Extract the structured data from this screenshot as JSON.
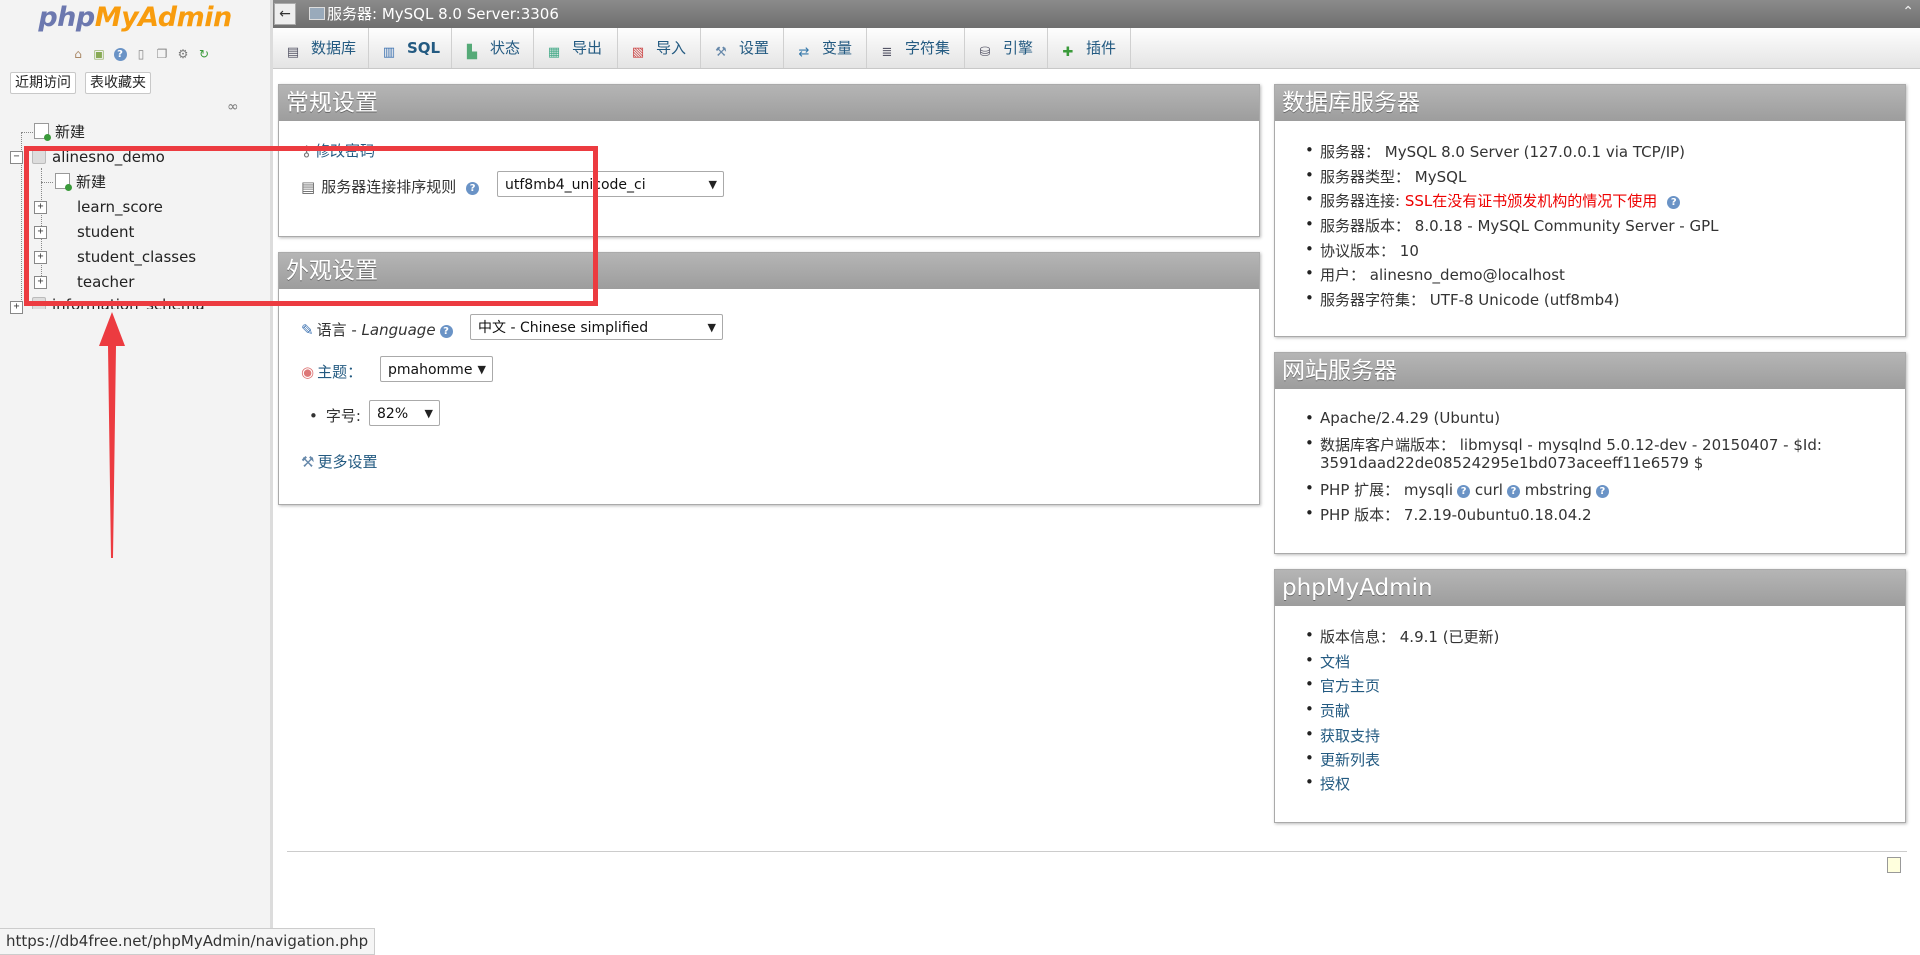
{
  "logo": {
    "part1": "php",
    "part2": "MyAdmin"
  },
  "nav": {
    "tabs": [
      "近期访问",
      "表收藏夹"
    ],
    "icons": [
      "home-icon",
      "exit-icon",
      "help-icon",
      "docs-icon",
      "copy-icon",
      "settings-icon",
      "reload-icon"
    ],
    "tree": {
      "new_root": "新建",
      "db1": "alinesno_demo",
      "db1_new": "新建",
      "tables": [
        "learn_score",
        "student",
        "student_classes",
        "teacher"
      ],
      "db2": "information_schema"
    },
    "status_url": "https://db4free.net/phpMyAdmin/navigation.php"
  },
  "titlebar": {
    "back": "←",
    "server": "服务器: MySQL 8.0 Server:3306"
  },
  "menu": [
    {
      "label": "数据库",
      "icon": "database-icon"
    },
    {
      "label": "SQL",
      "icon": "sql-icon"
    },
    {
      "label": "状态",
      "icon": "status-icon"
    },
    {
      "label": "导出",
      "icon": "export-icon"
    },
    {
      "label": "导入",
      "icon": "import-icon"
    },
    {
      "label": "设置",
      "icon": "wrench-icon"
    },
    {
      "label": "变量",
      "icon": "variables-icon"
    },
    {
      "label": "字符集",
      "icon": "charset-icon"
    },
    {
      "label": "引擎",
      "icon": "engine-icon"
    },
    {
      "label": "插件",
      "icon": "plugin-icon"
    }
  ],
  "general": {
    "title": "常规设置",
    "change_password": "修改密码",
    "collation_label": "服务器连接排序规则",
    "collation_value": "utf8mb4_unicode_ci"
  },
  "appearance": {
    "title": "外观设置",
    "language_label": "语言 - ",
    "language_label_en": "Language",
    "language_value": "中文 - Chinese simplified",
    "theme_label": "主题：",
    "theme_value": "pmahomme",
    "fontsize_label": "字号:",
    "fontsize_value": "82%",
    "more_settings": "更多设置"
  },
  "db_server": {
    "title": "数据库服务器",
    "items": [
      {
        "label": "服务器：",
        "value": "MySQL 8.0 Server (127.0.0.1 via TCP/IP)"
      },
      {
        "label": "服务器类型：",
        "value": "MySQL"
      },
      {
        "label": "服务器连接: ",
        "value": "SSL在没有证书颁发机构的情况下使用"
      },
      {
        "label": "服务器版本：",
        "value": "8.0.18 - MySQL Community Server - GPL"
      },
      {
        "label": "协议版本：",
        "value": "10"
      },
      {
        "label": "用户：",
        "value": "alinesno_demo@localhost"
      },
      {
        "label": "服务器字符集：",
        "value": "UTF-8 Unicode (utf8mb4)"
      }
    ]
  },
  "web_server": {
    "title": "网站服务器",
    "apache": "Apache/2.4.29 (Ubuntu)",
    "client_line1": "数据库客户端版本： libmysql - mysqlnd 5.0.12-dev - 20150407 - $Id:",
    "client_line2": "3591daad22de08524295e1bd073aceeff11e6579 $",
    "php_ext_label": "PHP 扩展： ",
    "php_ext": [
      "mysqli",
      "curl",
      "mbstring"
    ],
    "php_version": "PHP 版本： 7.2.19-0ubuntu0.18.04.2"
  },
  "pma": {
    "title": "phpMyAdmin",
    "version": "版本信息： 4.9.1 (已更新)",
    "links": [
      "文档",
      "官方主页",
      "贡献",
      "获取支持",
      "更新列表",
      "授权"
    ]
  },
  "colors": {
    "accent": "#235a81",
    "annotation": "#ec3b40",
    "panel_header": "#a9a9a9"
  }
}
